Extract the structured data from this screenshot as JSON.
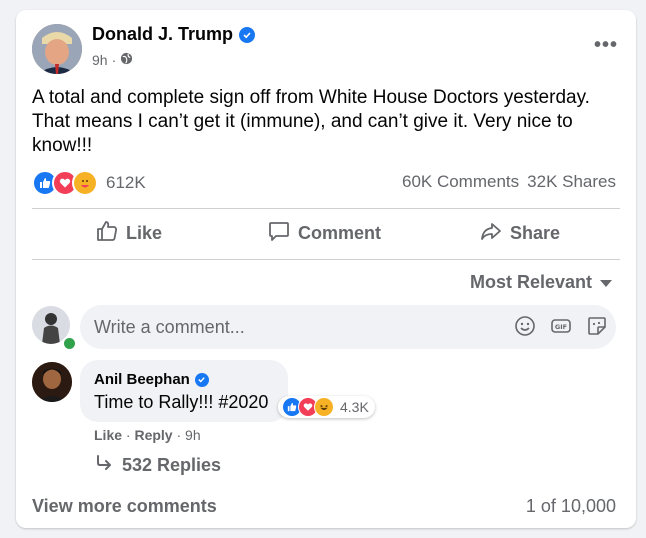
{
  "post": {
    "author": "Donald J. Trump",
    "time": "9h",
    "text": "A total and complete sign off from White House Doctors yesterday. That means I can’t get it (immune), and can’t give it. Very nice to know!!!",
    "reaction_count": "612K",
    "comments_count": "60K Comments",
    "shares_count": "32K Shares"
  },
  "actions": {
    "like": "Like",
    "comment": "Comment",
    "share": "Share"
  },
  "sort": {
    "label": "Most Relevant"
  },
  "comment_box": {
    "placeholder": "Write a comment..."
  },
  "comment": {
    "author": "Anil Beephan",
    "text": "Time to Rally!!! #2020",
    "reaction_count": "4.3K",
    "like_label": "Like",
    "reply_label": "Reply",
    "time": "9h"
  },
  "replies": {
    "label": "532 Replies"
  },
  "footer": {
    "view_more": "View more comments",
    "pager": "1 of 10,000"
  },
  "colors": {
    "like_blue": "#1877f2",
    "love_red": "#f33e58",
    "care_yellow": "#f7b125",
    "muted_text": "#65676b",
    "online_green": "#31a24c"
  }
}
